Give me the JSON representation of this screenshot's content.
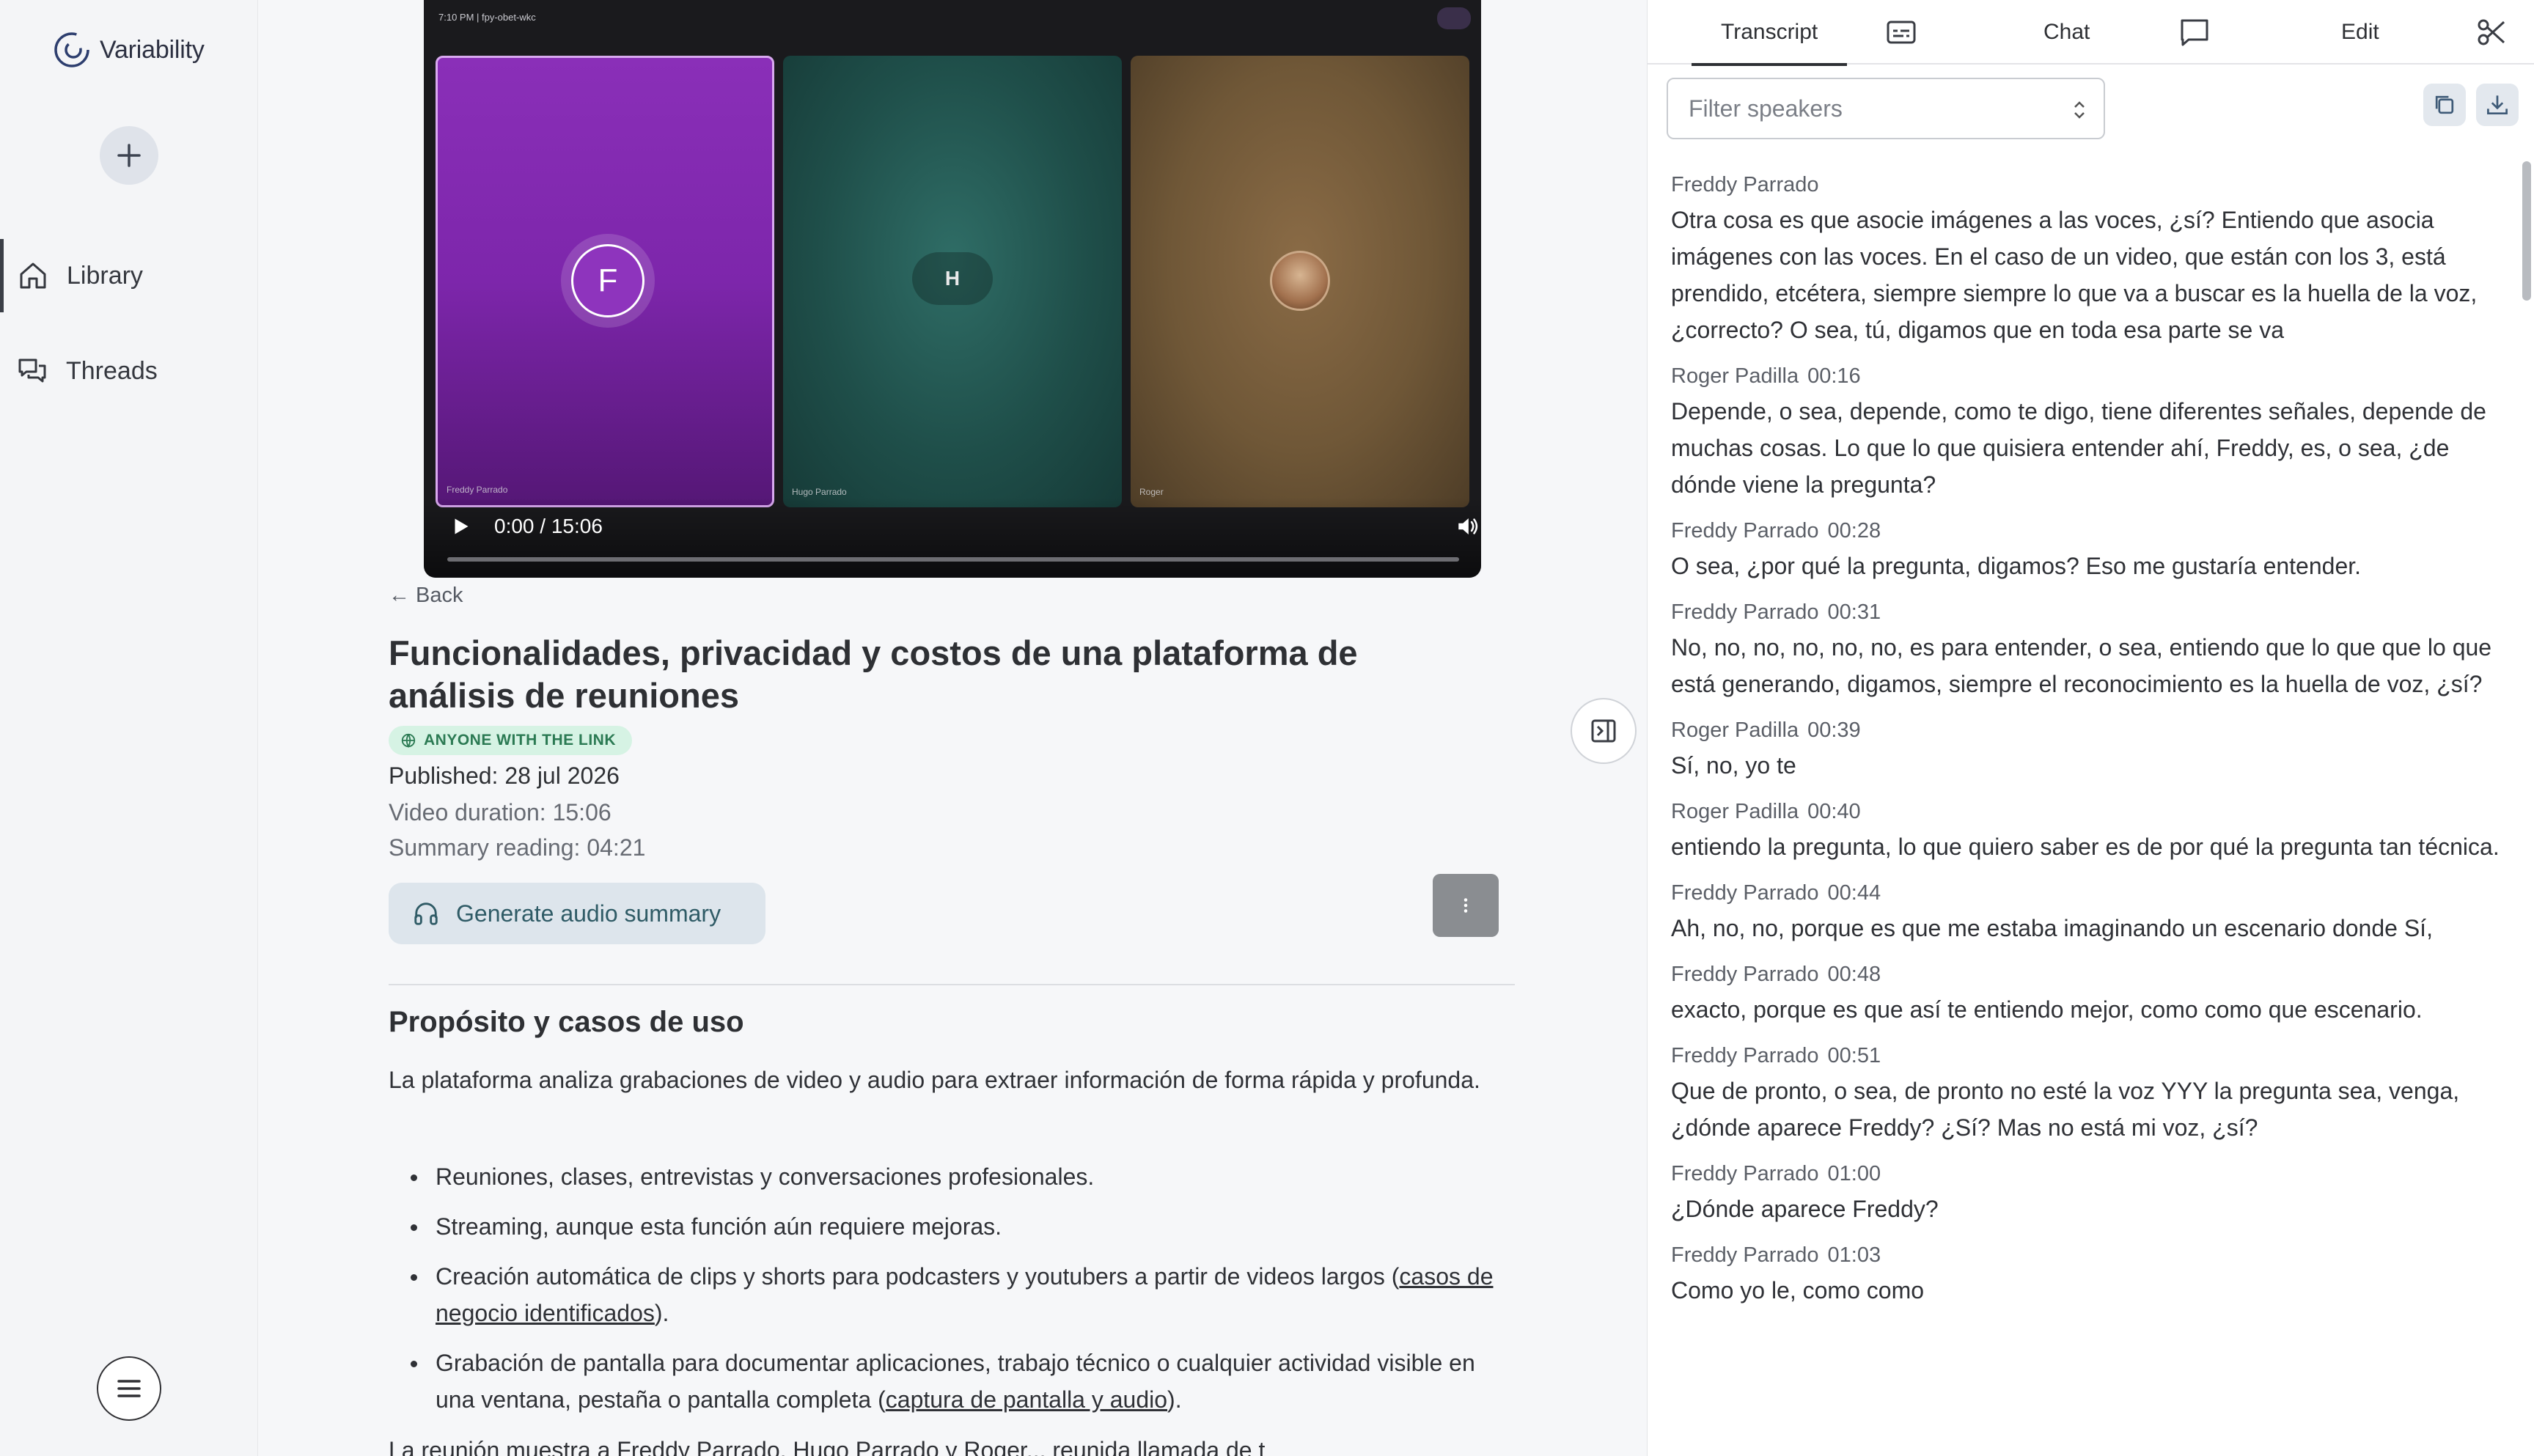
{
  "app": {
    "name": "Variability"
  },
  "sidebar": {
    "new_label": "+",
    "items": [
      {
        "label": "Library",
        "icon": "home-icon"
      },
      {
        "label": "Threads",
        "icon": "threads-icon"
      }
    ]
  },
  "video": {
    "top_bar": "7:10 PM  |  fpy-obet-wkc",
    "participants": [
      {
        "name": "Freddy Parrado",
        "initial": "F"
      },
      {
        "name": "Hugo Parrado",
        "initial": "H"
      },
      {
        "name": "Roger",
        "initial": ""
      }
    ],
    "time": "0:00 / 15:06",
    "progress": 0
  },
  "meeting": {
    "back_label": "Back",
    "title": "Funcionalidades, privacidad y costos de una plataforma de análisis de reuniones",
    "visibility": "ANYONE WITH THE LINK",
    "published": "Published: 28 jul 2026",
    "duration": "Video duration: 15:06",
    "reading": "Summary reading: 04:21",
    "audio_button": "Generate audio summary"
  },
  "summary": {
    "heading": "Propósito y casos de uso",
    "intro": "La plataforma analiza grabaciones de video y audio para extraer información de forma rápida y profunda.",
    "bullets": [
      {
        "text": "Reuniones, clases, entrevistas y conversaciones profesionales."
      },
      {
        "text": "Streaming, aunque esta función aún requiere mejoras."
      },
      {
        "text_before": "Creación automática de clips y shorts para podcasters y youtubers a partir de videos largos (",
        "link": "casos de negocio identificados",
        "text_after": ")."
      },
      {
        "text_before": "Grabación de pantalla para documentar aplicaciones, trabajo técnico o cualquier actividad visible en una ventana, pestaña o pantalla completa (",
        "link": "captura de pantalla y audio",
        "text_after": ")."
      }
    ],
    "cut_line": "La reunión muestra a Freddy Parrado, Hugo Parrado y Roger... reunida llamada de t"
  },
  "right_panel": {
    "tabs": [
      {
        "label": "Transcript",
        "icon": "subtitles-icon"
      },
      {
        "label": "Chat",
        "icon": "chat-icon"
      },
      {
        "label": "Edit",
        "icon": "scissors-icon"
      }
    ],
    "filter_placeholder": "Filter speakers",
    "copy_icon": "copy-icon",
    "download_icon": "download-icon",
    "segments": [
      {
        "speaker": "Freddy Parrado",
        "time": "",
        "text": "Otra cosa es que asocie imágenes a las voces, ¿sí? Entiendo que asocia imágenes con las voces. En el caso de un video, que están con los 3, está prendido, etcétera, siempre siempre lo que va a buscar es la huella de la voz, ¿correcto? O sea, tú, digamos que en toda esa parte se va"
      },
      {
        "speaker": "Roger Padilla",
        "time": "00:16",
        "text": "Depende, o sea, depende, como te digo, tiene diferentes señales, depende de muchas cosas. Lo que lo que quisiera entender ahí, Freddy, es, o sea, ¿de dónde viene la pregunta?"
      },
      {
        "speaker": "Freddy Parrado",
        "time": "00:28",
        "text": "O sea, ¿por qué la pregunta, digamos? Eso me gustaría entender."
      },
      {
        "speaker": "Freddy Parrado",
        "time": "00:31",
        "text": "No, no, no, no, no, no, es para entender, o sea, entiendo que lo que que lo que está generando, digamos, siempre el reconocimiento es la huella de voz, ¿sí?"
      },
      {
        "speaker": "Roger Padilla",
        "time": "00:39",
        "text": "Sí, no, yo te"
      },
      {
        "speaker": "Roger Padilla",
        "time": "00:40",
        "text": "entiendo la pregunta, lo que quiero saber es de por qué la pregunta tan técnica."
      },
      {
        "speaker": "Freddy Parrado",
        "time": "00:44",
        "text": "Ah, no, no, porque es que me estaba imaginando un escenario donde Sí,"
      },
      {
        "speaker": "Freddy Parrado",
        "time": "00:48",
        "text": "exacto, porque es que así te entiendo mejor, como como que escenario."
      },
      {
        "speaker": "Freddy Parrado",
        "time": "00:51",
        "text": "Que de pronto, o sea, de pronto no esté la voz YYY la pregunta sea, venga, ¿dónde aparece Freddy? ¿Sí? Mas no está mi voz, ¿sí?"
      },
      {
        "speaker": "Freddy Parrado",
        "time": "01:00",
        "text": "¿Dónde aparece Freddy?"
      },
      {
        "speaker": "Freddy Parrado",
        "time": "01:03",
        "text": "Como yo le, como como"
      }
    ]
  }
}
